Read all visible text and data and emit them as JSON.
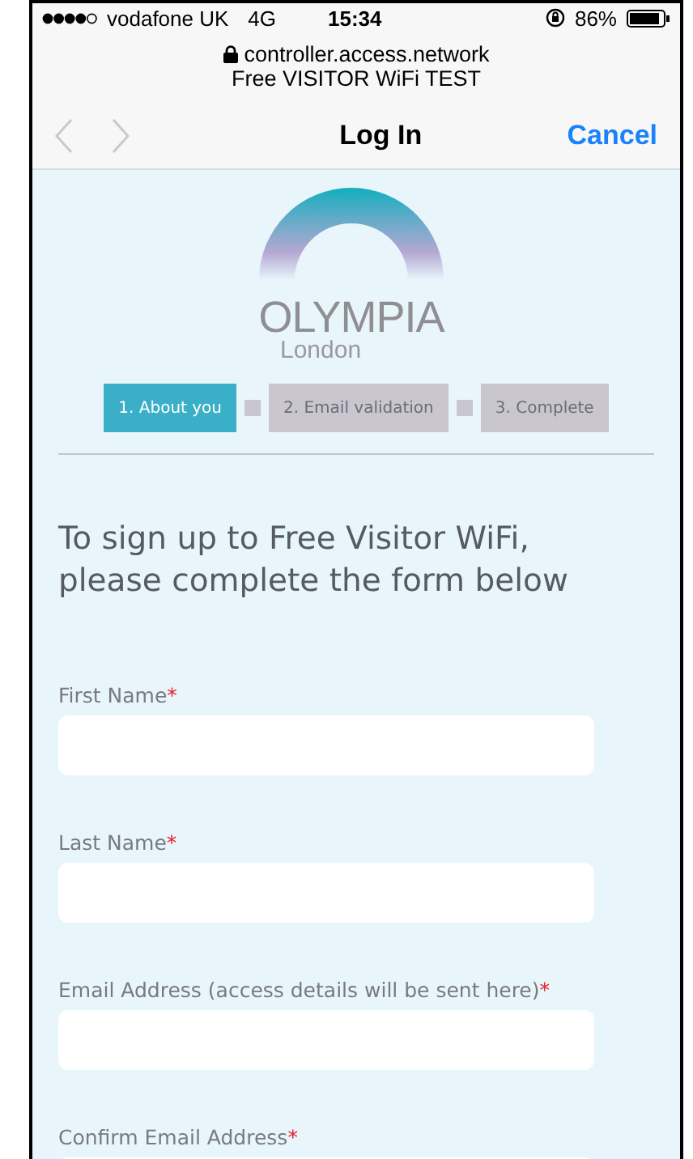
{
  "status_bar": {
    "carrier": "vodafone UK",
    "network": "4G",
    "time": "15:34",
    "battery": "86%"
  },
  "browser": {
    "url": "controller.access.network",
    "page_title": "Free VISITOR WiFi TEST",
    "title": "Log In",
    "cancel": "Cancel",
    "back_disabled": true,
    "forward_disabled": true
  },
  "logo": {
    "name": "OLYMPIA",
    "place": "London"
  },
  "steps": [
    {
      "label": "1. About you",
      "selected": true
    },
    {
      "label": "2. Email validation",
      "selected": false
    },
    {
      "label": "3. Complete",
      "selected": false
    }
  ],
  "heading": "To sign up to Free Visitor WiFi, please complete the form below",
  "fields": [
    {
      "label": "First Name",
      "mark": "*"
    },
    {
      "label": "Last Name",
      "mark": "*"
    },
    {
      "label": "Email Address (access details will be sent here)",
      "mark": "*"
    },
    {
      "label": "Confirm Email Address",
      "mark": "*"
    }
  ]
}
